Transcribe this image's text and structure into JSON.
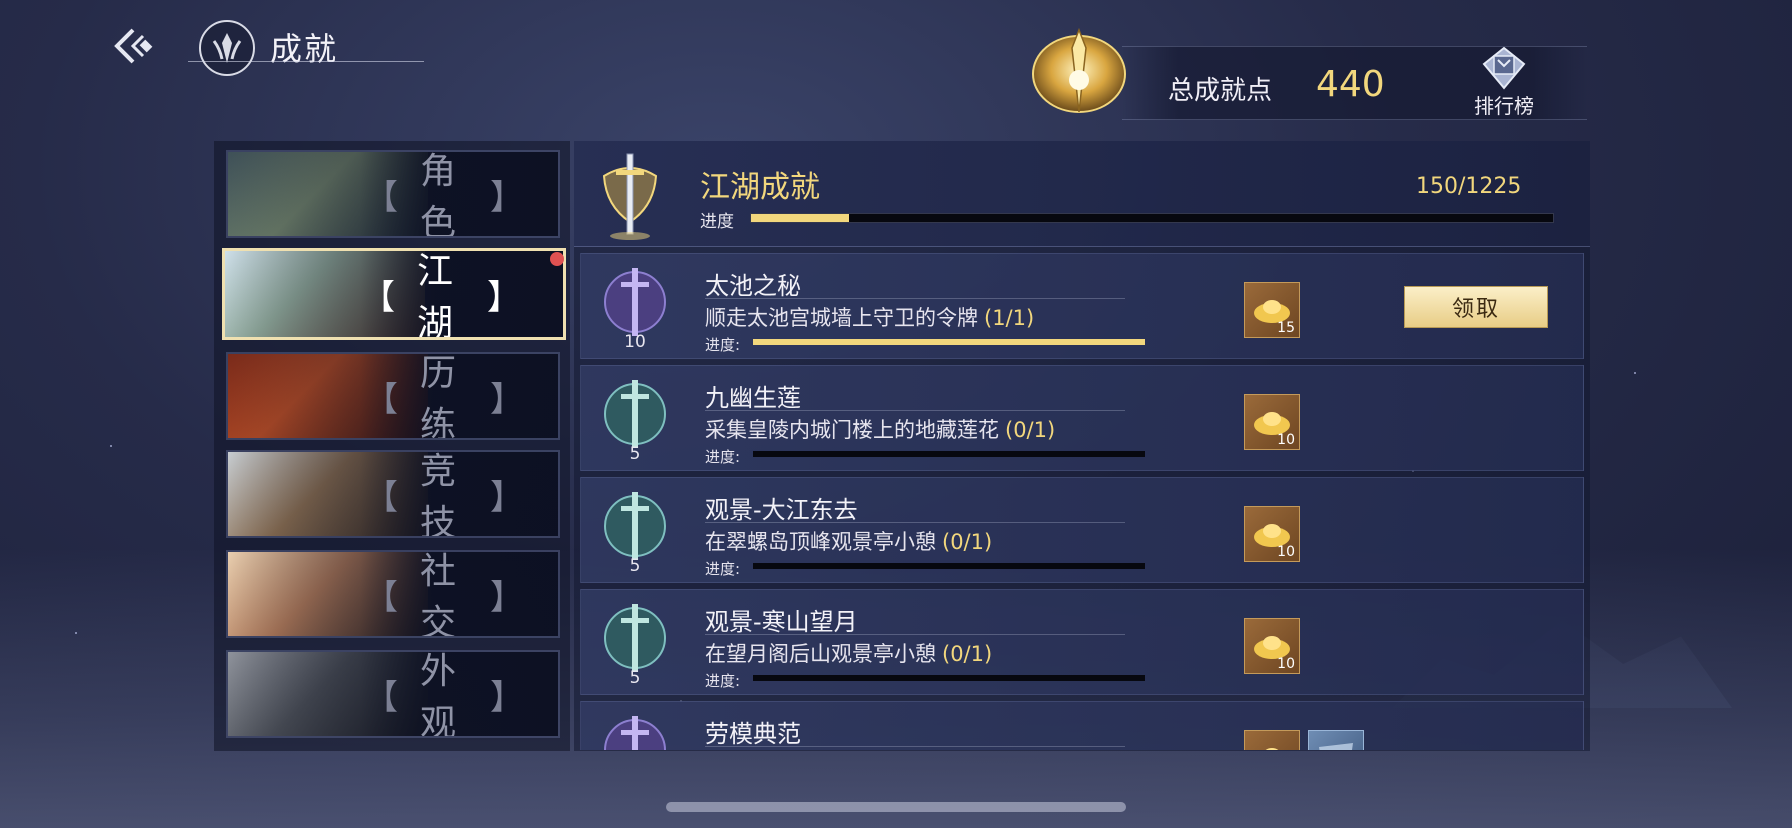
{
  "header": {
    "title": "成就",
    "total_label": "总成就点",
    "total_value": "440",
    "ranking_label": "排行榜"
  },
  "categories": [
    {
      "label": "角色",
      "active": false
    },
    {
      "label": "江湖",
      "active": true,
      "has_notification": true
    },
    {
      "label": "历练",
      "active": false
    },
    {
      "label": "竞技",
      "active": false
    },
    {
      "label": "社交",
      "active": false
    },
    {
      "label": "外观",
      "active": false
    }
  ],
  "bracket_left": "【",
  "bracket_right": "】",
  "category_header": {
    "title": "江湖成就",
    "progress_label": "进度",
    "progress_text": "150/1225",
    "progress_fraction": 0.122
  },
  "achievements": [
    {
      "name": "太池之秘",
      "desc": "顺走太池宫城墙上守卫的令牌",
      "progress": "(1/1)",
      "progress_label": "进度:",
      "fraction": 1.0,
      "points": "10",
      "medal": "purple",
      "rewards": [
        {
          "qty": "15",
          "type": "gold-ingot"
        }
      ],
      "claim_label": "领取"
    },
    {
      "name": "九幽生莲",
      "desc": "采集皇陵内城门楼上的地藏莲花",
      "progress": "(0/1)",
      "progress_label": "进度:",
      "fraction": 0,
      "points": "5",
      "medal": "teal",
      "rewards": [
        {
          "qty": "10",
          "type": "gold-ingot"
        }
      ]
    },
    {
      "name": "观景-大江东去",
      "desc": "在翠螺岛顶峰观景亭小憩",
      "progress": "(0/1)",
      "progress_label": "进度:",
      "fraction": 0,
      "points": "5",
      "medal": "teal",
      "rewards": [
        {
          "qty": "10",
          "type": "gold-ingot"
        }
      ]
    },
    {
      "name": "观景-寒山望月",
      "desc": "在望月阁后山观景亭小憩",
      "progress": "(0/1)",
      "progress_label": "进度:",
      "fraction": 0,
      "points": "5",
      "medal": "teal",
      "rewards": [
        {
          "qty": "10",
          "type": "gold-ingot"
        }
      ]
    },
    {
      "name": "劳模典范",
      "medal": "purple",
      "rewards": [
        {
          "type": "gold-ingot"
        },
        {
          "type": "blue-item"
        }
      ]
    }
  ],
  "colors": {
    "accent_gold": "#f2d77d",
    "background": "#262b49",
    "notification": "#e05252"
  },
  "icons": {
    "back": "back-arrow-icon",
    "emblem": "sect-emblem-icon",
    "total": "golden-crest-icon",
    "ranking": "ranking-banner-icon",
    "reward": "gold-ingot-icon"
  }
}
